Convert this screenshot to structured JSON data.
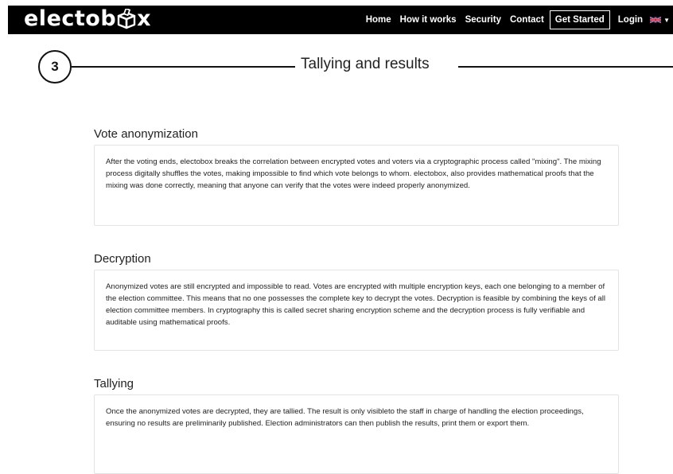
{
  "nav": {
    "logo": "electobox",
    "links": [
      "Home",
      "How it works",
      "Security",
      "Contact"
    ],
    "get_started": "Get Started",
    "login": "Login",
    "language_icon": "uk-flag-icon"
  },
  "step": {
    "number": "3",
    "title": "Tallying and results"
  },
  "sections": [
    {
      "title": "Vote anonymization",
      "body": "After the voting ends, electobox breaks the correlation between encrypted votes and voters via a cryptographic process called \"mixing\". The mixing process digitally shuffles the votes, making impossible to find which vote belongs to whom. electobox, also provides mathematical proofs that the mixing was done correctly, meaning that anyone can verify that the votes were indeed properly anonymized."
    },
    {
      "title": "Decryption",
      "body": "Anonymized votes are still encrypted and impossible to read. Votes are encrypted with multiple encryption keys, each one belonging to a member of the election committee. This means that no one possesses the complete key to decrypt the votes. Decryption is feasible by combining the keys of all election committee members. In cryptography this is called secret sharing encryption scheme and the decryption process is fully verifiable and auditable using mathematical proofs."
    },
    {
      "title": "Tallying",
      "body": "Once the anonymized votes are decrypted, they are tallied. The result is only visibleto the staff in charge of handling the election proceedings, ensuring no results are preliminarily published. Election administrators can then publish the results, print them or export them."
    }
  ]
}
